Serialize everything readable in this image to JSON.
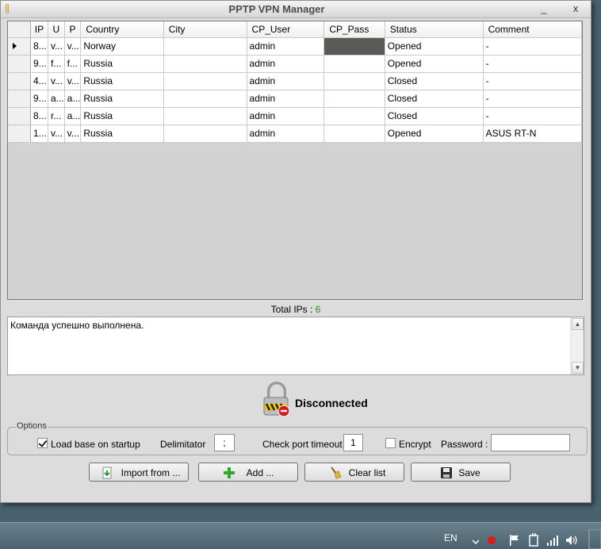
{
  "window": {
    "title": "PPTP VPN Manager",
    "minimize_glyph": "_",
    "close_glyph": "x"
  },
  "grid": {
    "columns": [
      "IP",
      "U",
      "P",
      "Country",
      "City",
      "CP_User",
      "CP_Pass",
      "Status",
      "Comment"
    ],
    "rows": [
      {
        "ip": "8...",
        "u": "v...",
        "p": "v...",
        "country": "Norway",
        "city": "",
        "cp_user": "admin",
        "cp_pass": "",
        "status": "Opened",
        "comment": "-"
      },
      {
        "ip": "9...",
        "u": "f...",
        "p": "f...",
        "country": "Russia",
        "city": "",
        "cp_user": "admin",
        "cp_pass": "",
        "status": "Opened",
        "comment": "-"
      },
      {
        "ip": "4...",
        "u": "v...",
        "p": "v...",
        "country": "Russia",
        "city": "",
        "cp_user": "admin",
        "cp_pass": "",
        "status": "Closed",
        "comment": "-"
      },
      {
        "ip": "9...",
        "u": "a...",
        "p": "a...",
        "country": "Russia",
        "city": "",
        "cp_user": "admin",
        "cp_pass": "",
        "status": "Closed",
        "comment": "-"
      },
      {
        "ip": "8...",
        "u": "r...",
        "p": "a...",
        "country": "Russia",
        "city": "",
        "cp_user": "admin",
        "cp_pass": "",
        "status": "Closed",
        "comment": "-"
      },
      {
        "ip": "1...",
        "u": "v...",
        "p": "v...",
        "country": "Russia",
        "city": "",
        "cp_user": "admin",
        "cp_pass": "",
        "status": "Opened",
        "comment": "ASUS RT-N"
      }
    ],
    "selected_row": 0
  },
  "total": {
    "label": "Total IPs :",
    "value": "6",
    "value_color": "#2e8b2e"
  },
  "log": {
    "text": "Команда успешно выполнена."
  },
  "connection": {
    "status_text": "Disconnected",
    "icon": "lock-disconnected-icon"
  },
  "options": {
    "legend": "Options",
    "load_base_label": "Load base on startup",
    "load_base_checked": true,
    "delimitator_label": "Delimitator",
    "delimitator_value": ";",
    "check_port_label": "Check port timeout :",
    "check_port_value": "1",
    "encrypt_label": "Encrypt",
    "encrypt_checked": false,
    "password_label": "Password :",
    "password_value": ""
  },
  "buttons": {
    "import": "Import from ...",
    "add": "Add ...",
    "clear": "Clear list",
    "save": "Save"
  },
  "taskbar": {
    "language": "EN"
  }
}
